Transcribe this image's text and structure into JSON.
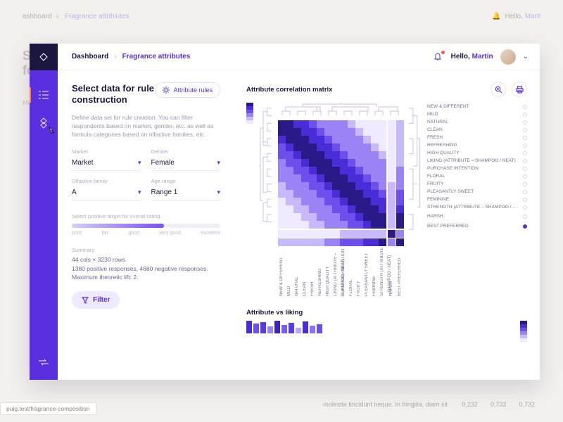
{
  "ghost": {
    "breadcrumb": [
      "ashboard",
      "Fragrance attribiutes"
    ],
    "hello_prefix": "Hello,",
    "hello_name": "Marti",
    "title1": "Sele",
    "title2": "for r",
    "lbl_market": "Marke",
    "row_text": "molestie tincidunt neque. In fringilla, diam sit",
    "nums": [
      "0,232",
      "0,732",
      "0,732"
    ]
  },
  "breadcrumb": {
    "root": "Dashboard",
    "page": "Fragrance attributes"
  },
  "user": {
    "hello_prefix": "Hello,",
    "name": "Martin"
  },
  "config": {
    "title": "Select data for rule construction",
    "attr_rules_btn": "Attribute rules",
    "desc": "Define data set for rule creation. You can filter respondents based on market, gender, etc. as well as formula categories based on olfactive families, etc.",
    "selects": {
      "market": {
        "label": "Market",
        "value": "Market"
      },
      "gender": {
        "label": "Gender",
        "value": "Female"
      },
      "olfactive": {
        "label": "Olfactive family",
        "value": "A"
      },
      "age": {
        "label": "Age range",
        "value": "Range 1"
      }
    },
    "slider_label": "Select positive target for overall rating",
    "slider_ticks": [
      "poor",
      "fair",
      "good",
      "very good",
      "excellent"
    ],
    "summary_label": "Summary",
    "summary_line1": "44 cols × 3230 rows.",
    "summary_line2": "1380 positive responses, 4680 negative responses.",
    "summary_line3": "Maximum theoretic lift: 2.",
    "filter_btn": "Filter"
  },
  "viz": {
    "matrix_title": "Attribute correlation matrix",
    "liking_title": "Attribute vs liking",
    "legend_colors": [
      "#2a1a87",
      "#4b2cd6",
      "#6e4eec",
      "#9b82f5",
      "#c7b9fb",
      "#efeaff"
    ],
    "row_labels": [
      "NEW & DIFFERENT",
      "MILD",
      "NATURAL",
      "CLEAN",
      "FRESH",
      "REFRESHING",
      "HIGH QUALITY",
      "LIKING (ATTRIBUTE – SHAMPOO / NEAT)",
      "PURCHASE INTENTION",
      "FLORAL",
      "FRUITY",
      "PLEASANTLY SWEET",
      "FEMININE",
      "STRENGTH (ATTRIBUTE – SHAMPOO / NEAT)",
      "HARSH",
      "BEST PREFERRED"
    ],
    "toggles_on": [
      15
    ]
  },
  "chart_data": {
    "type": "heatmap",
    "title": "Attribute correlation matrix",
    "axes_labels": [
      "NEW & DIFFERENT",
      "MILD",
      "NATURAL",
      "CLEAN",
      "FRESH",
      "REFRESHING",
      "HIGH QUALITY",
      "LIKING (ATTRIBUTE – SHAMPOO / NEAT)",
      "PURCHASE INTENTION",
      "FLORAL",
      "FRUITY",
      "PLEASANTLY SWEET",
      "FEMININE",
      "STRENGTH (ATTRIBUTE – SHAMPOO / NEAT)",
      "HARSH",
      "BEST PREFERRED"
    ],
    "scale": {
      "min": 0,
      "max": 1,
      "colors": [
        "#efeaff",
        "#c7b9fb",
        "#9b82f5",
        "#6e4eec",
        "#4b2cd6",
        "#2a1a87"
      ]
    },
    "note": "Symmetric correlation matrix; diagonal = 1.0. Row 15 (HARSH) and col 15 visually separated. Cell values estimated from color ramp, not labeled."
  },
  "url_chip": "puig.test/fragrance-composition"
}
